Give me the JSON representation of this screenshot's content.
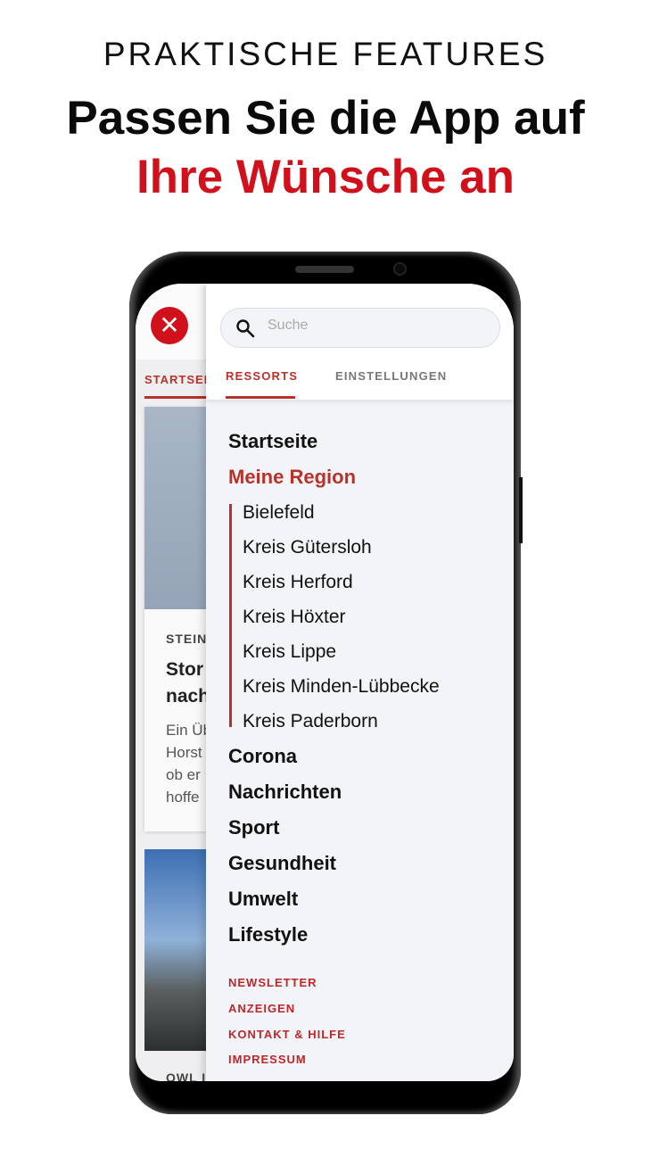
{
  "promo": {
    "kicker": "PRAKTISCHE FEATURES",
    "headline_line1": "Passen Sie die App auf",
    "headline_line2": "Ihre Wünsche an",
    "accent": "#d0111b"
  },
  "background_app": {
    "tab": "STARTSEI",
    "card": {
      "label": "STEIN",
      "title_lines": [
        "Stor",
        "nach"
      ],
      "body_lines": [
        "Ein Üb",
        "Horst",
        "ob er",
        "hoffe"
      ]
    },
    "next_label": "OWL I"
  },
  "drawer": {
    "search": {
      "placeholder": "Suche"
    },
    "tabs": [
      {
        "label": "RESSORTS",
        "active": true
      },
      {
        "label": "EINSTELLUNGEN",
        "active": false
      }
    ],
    "items": [
      {
        "label": "Startseite"
      },
      {
        "label": "Meine Region",
        "active": true
      }
    ],
    "subitems": [
      "Bielefeld",
      "Kreis Gütersloh",
      "Kreis Herford",
      "Kreis Höxter",
      "Kreis Lippe",
      "Kreis Minden-Lübbecke",
      "Kreis Paderborn"
    ],
    "more_items": [
      "Corona",
      "Nachrichten",
      "Sport",
      "Gesundheit",
      "Umwelt",
      "Lifestyle"
    ],
    "footer_links": [
      "NEWSLETTER",
      "ANZEIGEN",
      "KONTAKT & HILFE",
      "IMPRESSUM"
    ],
    "active_color": "#b8322a"
  }
}
